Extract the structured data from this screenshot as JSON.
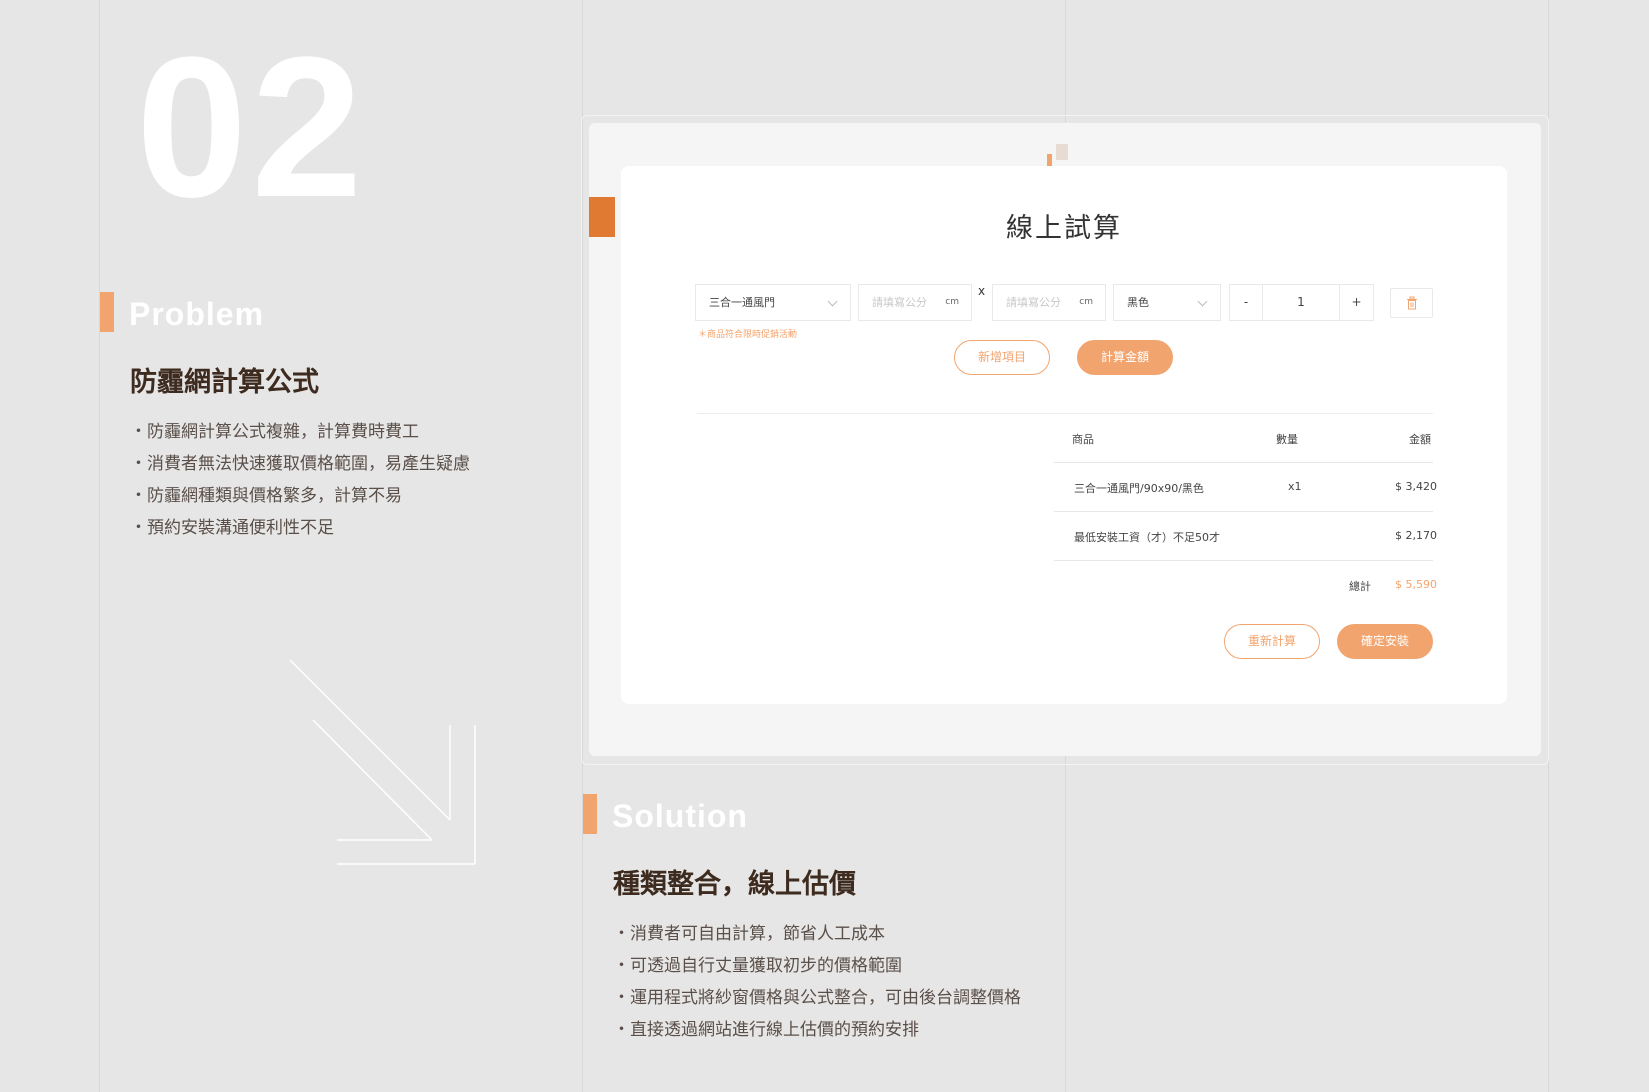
{
  "section_number": "02",
  "problem": {
    "label": "Problem",
    "heading": "防霾網計算公式",
    "bullets": [
      "防霾網計算公式複雜，計算費時費工",
      "消費者無法快速獲取價格範圍，易產生疑慮",
      "防霾網種類與價格繁多，計算不易",
      "預約安裝溝通便利性不足"
    ]
  },
  "solution": {
    "label": "Solution",
    "heading": "種類整合，線上估價",
    "bullets": [
      "消費者可自由計算，節省人工成本",
      "可透過自行丈量獲取初步的價格範圍",
      "運用程式將紗窗價格與公式整合，可由後台調整價格",
      "直接透過網站進行線上估價的預約安排"
    ]
  },
  "calculator": {
    "title": "線上試算",
    "product_select": "三合一通風門",
    "width_placeholder": "請填寫公分",
    "height_placeholder": "請填寫公分",
    "unit": "cm",
    "times": "x",
    "color_select": "黑色",
    "qty_minus": "-",
    "qty_value": "1",
    "qty_plus": "+",
    "promo_note": "＊商品符合限時促銷活動",
    "add_item_label": "新增項目",
    "calculate_label": "計算金額",
    "table": {
      "headers": [
        "商品",
        "數量",
        "金額"
      ],
      "rows": [
        {
          "item": "三合一通風門/90x90/黑色",
          "qty": "x1",
          "amount": "$ 3,420"
        },
        {
          "item": "最低安裝工資（才）不足50才",
          "qty": "",
          "amount": "$ 2,170"
        }
      ],
      "total_label": "總計",
      "total_value": "$ 5,590"
    },
    "recalculate_label": "重新計算",
    "confirm_label": "確定安裝"
  },
  "colors": {
    "accent": "#f2a46e",
    "accent_dark": "#e07a33",
    "background": "#e7e6e6",
    "heading": "#3d2b1f"
  },
  "icons": [
    "trash-icon",
    "chevron-down-icon",
    "arrow-down-right-icon"
  ]
}
